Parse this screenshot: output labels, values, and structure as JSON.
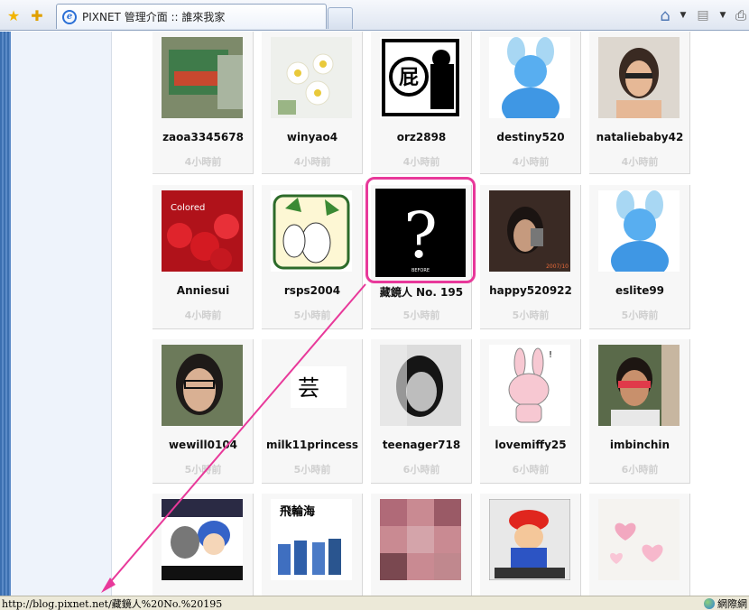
{
  "browser": {
    "tab_title": "PIXNET 管理介面 :: 誰來我家",
    "status_url": "http://blog.pixnet.net/藏鏡人%20No.%20195",
    "status_zone": "網際網"
  },
  "visitors": [
    {
      "name": "zaoa3345678",
      "time": "4小時前",
      "avatar": "photo-bag"
    },
    {
      "name": "winyao4",
      "time": "4小時前",
      "avatar": "photo-flowers"
    },
    {
      "name": "orz2898",
      "time": "4小時前",
      "avatar": "orz-logo"
    },
    {
      "name": "destiny520",
      "time": "4小時前",
      "avatar": "default-avatar"
    },
    {
      "name": "nataliebaby42",
      "time": "4小時前",
      "avatar": "photo-woman"
    },
    {
      "name": "Anniesui",
      "time": "4小時前",
      "avatar": "photo-strawberries"
    },
    {
      "name": "rsps2004",
      "time": "5小時前",
      "avatar": "radish-cartoon"
    },
    {
      "name": "藏鏡人 No. 195",
      "time": "5小時前",
      "avatar": "question-mark",
      "highlighted": true
    },
    {
      "name": "happy520922",
      "time": "5小時前",
      "avatar": "photo-selfie"
    },
    {
      "name": "eslite99",
      "time": "5小時前",
      "avatar": "default-avatar"
    },
    {
      "name": "wewill0104",
      "time": "5小時前",
      "avatar": "photo-glasses-girl"
    },
    {
      "name": "milk11princess",
      "time": "5小時前",
      "avatar": "small-logo"
    },
    {
      "name": "teenager718",
      "time": "6小時前",
      "avatar": "photo-bw-girl"
    },
    {
      "name": "lovemiffy25",
      "time": "6小時前",
      "avatar": "rabbit-cartoon"
    },
    {
      "name": "imbinchin",
      "time": "6小時前",
      "avatar": "photo-red-glasses"
    },
    {
      "name": "",
      "time": "",
      "avatar": "anime-boy"
    },
    {
      "name": "",
      "time": "",
      "avatar": "photo-band"
    },
    {
      "name": "",
      "time": "",
      "avatar": "pixelated-photo"
    },
    {
      "name": "",
      "time": "",
      "avatar": "mario"
    },
    {
      "name": "",
      "time": "",
      "avatar": "pink-hearts"
    }
  ],
  "colors": {
    "highlight": "#e8399a",
    "time_text": "#cfcfcf"
  }
}
